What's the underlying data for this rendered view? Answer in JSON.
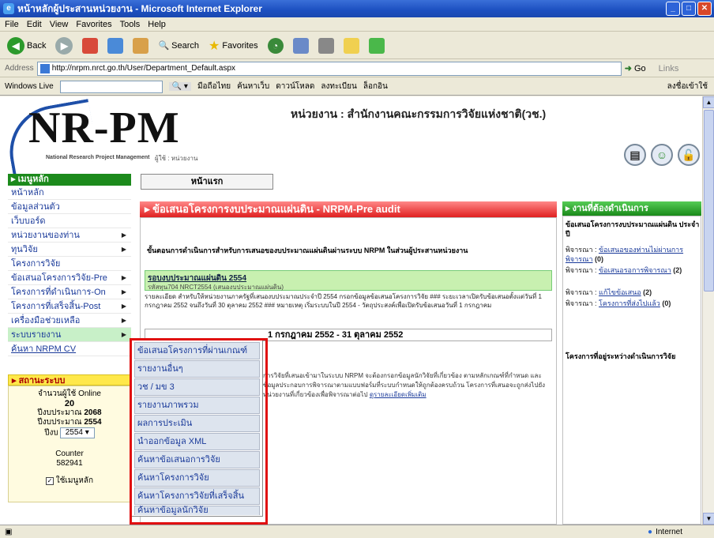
{
  "window": {
    "title": "หน้าหลักผู้ประสานหน่วยงาน - Microsoft Internet Explorer"
  },
  "menubar": [
    "File",
    "Edit",
    "View",
    "Favorites",
    "Tools",
    "Help"
  ],
  "toolbar": {
    "back": "Back",
    "search": "Search",
    "favorites": "Favorites"
  },
  "address": {
    "label": "Address",
    "url": "http://nrpm.nrct.go.th/User/Department_Default.aspx",
    "go": "Go",
    "links": "Links"
  },
  "linksbar": {
    "live": "Windows Live",
    "items": [
      "มือถือไทย",
      "ค้นหาเว็บ",
      "ดาวน์โหลด",
      "ลงทะเบียน",
      "ล็อกอิน"
    ],
    "extra": "ลงชื่อเข้าใช้"
  },
  "header": {
    "logo": "NR-PM",
    "logo_sub": "National Research Project Management",
    "logo_sub2": "ผู้ใช้ : หน่วยงาน",
    "org": "หน่วยงาน : สำนักงานคณะกรรมการวิจัยแห่งชาติ(วช.)"
  },
  "left": {
    "menu_header": "เมนูหลัก",
    "items": [
      {
        "label": "หน้าหลัก",
        "arrow": ""
      },
      {
        "label": "ข้อมูลส่วนตัว",
        "arrow": ""
      },
      {
        "label": "เว็บบอร์ด",
        "arrow": ""
      },
      {
        "label": "หน่วยงานของท่าน",
        "arrow": "▶"
      },
      {
        "label": "ทุนวิจัย",
        "arrow": "▶"
      },
      {
        "label": "โครงการวิจัย",
        "arrow": ""
      },
      {
        "label": "ข้อเสนอโครงการวิจัย-Pre",
        "arrow": "▶"
      },
      {
        "label": "โครงการที่ดำเนินการ-On",
        "arrow": "▶"
      },
      {
        "label": "โครงการที่เสร็จสิ้น-Post",
        "arrow": "▶"
      },
      {
        "label": "เครื่องมือช่วยเหลือ",
        "arrow": "▶"
      },
      {
        "label": "ระบบรายงาน",
        "arrow": "▶"
      },
      {
        "label": "ค้นหา NRPM CV",
        "arrow": ""
      }
    ],
    "status_header": "สถานะระบบ",
    "status": {
      "online_label": "จำนวนผู้ใช้ Online",
      "online": "20",
      "fiscal_label": "ปีงบประมาณ",
      "fiscal": "2068",
      "budget_label": "ปีงบประมาณ",
      "budget": "2554",
      "year_label": "ปีงบ",
      "year": "2554",
      "counter_label": "Counter",
      "counter": "582941",
      "remember": "ใช้เมนูหลัก"
    }
  },
  "tab": {
    "title": "หน้าแรก"
  },
  "main": {
    "header": "ข้อเสนอโครงการงบประมาณแผ่นดิน - NRPM-Pre audit",
    "message": "ขั้นตอนการดำเนินการสำหรับการเสนอของบประมาณแผ่นดินผ่านระบบ NRPM ในส่วนผู้ประสานหน่วยงาน",
    "green_title": "รอบงบประมาณแผ่นดิน 2554",
    "green_sub": "รหัสทุน704 NRCT2554 (เสนองบประมาณแผ่นดิน)",
    "notice": "รายละเอียด สำหรับให้หน่วยงานภาครัฐที่เสนองบประมาณประจำปี 2554 กรอกข้อมูลข้อเสนอโครงการวิจัย ### ระยะเวลาเปิดรับข้อเสนอตั้งแต่วันที่ 1 กรกฎาคม 2552 จนถึงวันที่ 30 ตุลาคม 2552 ### หมายเหตุ เริ่มระบบในปี 2554 - วัตถุประสงค์เพื่อเปิดรับข้อเสนอวันที่ 1 กรกฎาคม",
    "date": "1 กรกฎาคม 2552 - 31 ตุลาคม 2552",
    "body": "การวิจัยที่เสนอเข้ามาในระบบ NRPM จะต้องกรอกข้อมูลนักวิจัยที่เกี่ยวข้อง ตามหลักเกณฑ์ที่กำหนด และข้อมูลประกอบการพิจารณาตามแบบฟอร์มที่ระบบกำหนดให้ถูกต้องครบถ้วน โครงการที่เสนอจะถูกส่งไปยังหน่วยงานที่เกี่ยวข้องเพื่อพิจารณาต่อไป",
    "body_link": "ดูรายละเอียดเพิ่มเติม"
  },
  "popup": [
    "ข้อเสนอโครงการที่ผ่านเกณฑ์",
    "รายงานอื่นๆ",
    "วช / มข 3",
    "รายงานภาพรวม",
    "ผลการประเมิน",
    "นำออกข้อมูล XML",
    "ค้นหาข้อเสนอการวิจัย",
    "ค้นหาโครงการวิจัย",
    "ค้นหาโครงการวิจัยที่เสร็จสิ้นแล้ว",
    "ค้นหาข้อมูลนักวิจัย"
  ],
  "right": {
    "header": "งานที่ต้องดำเนินการ",
    "title": "ข้อเสนอโครงการงบประมาณแผ่นดิน ประจำปี",
    "items": [
      {
        "label": "พิจารณา :",
        "link": "ข้อเสนอของท่านไม่ผ่านการพิจารณา",
        "count": "(0)"
      },
      {
        "label": "พิจารณา :",
        "link": "ข้อเสนอรอการพิจารณา",
        "count": "(2)"
      },
      {
        "label": "พิจารณา :",
        "link": "แก้ไขข้อเสนอ",
        "count": "(2)"
      },
      {
        "label": "พิจารณา :",
        "link": "โครงการที่ส่งไปแล้ว",
        "count": "(0)"
      }
    ],
    "title2": "โครงการที่อยู่ระหว่างดำเนินการวิจัย"
  },
  "statusbar": {
    "zone": "Internet"
  }
}
